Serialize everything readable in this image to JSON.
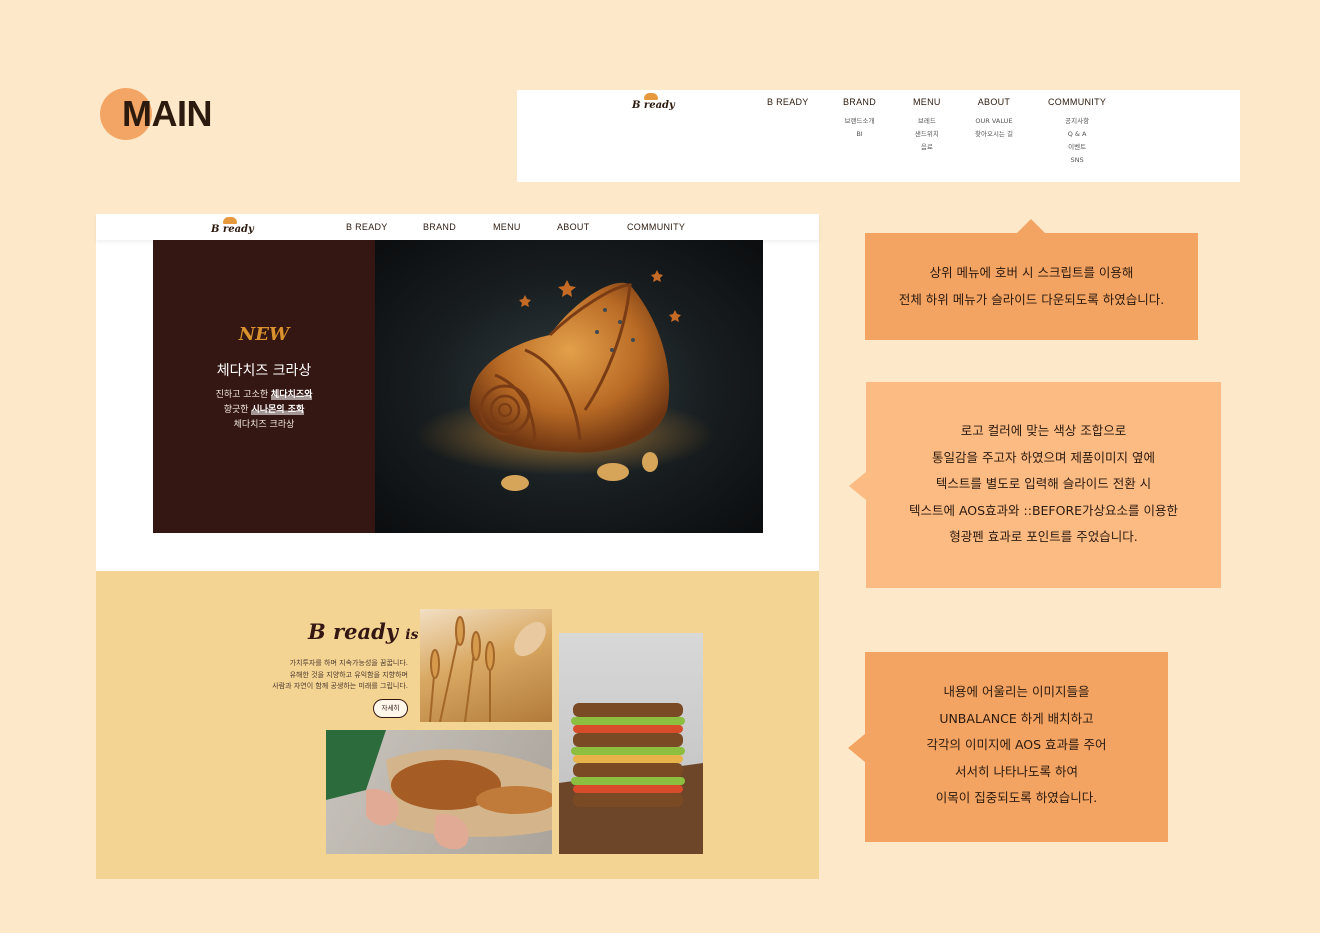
{
  "section_title": "MAIN",
  "logo": {
    "text": "B ready"
  },
  "dropdown": {
    "menus": [
      {
        "label": "B READY",
        "items": []
      },
      {
        "label": "BRAND",
        "items": [
          "브랜드소개",
          "BI"
        ]
      },
      {
        "label": "MENU",
        "items": [
          "브레드",
          "샌드위치",
          "음료"
        ]
      },
      {
        "label": "ABOUT",
        "items": [
          "OUR VALUE",
          "찾아오시는 길"
        ]
      },
      {
        "label": "COMMUNITY",
        "items": [
          "공지사항",
          "Q & A",
          "이벤트",
          "SNS"
        ]
      }
    ]
  },
  "nav": [
    "B READY",
    "BRAND",
    "MENU",
    "ABOUT",
    "COMMUNITY"
  ],
  "hero": {
    "badge": "NEW",
    "title": "체다치즈 크라상",
    "desc_1": "진하고 고소한 ",
    "desc_1_hl": "체다치즈와",
    "desc_2": "향긋한 ",
    "desc_2_hl": "시나몬의 조화",
    "desc_3": "체다치즈 크라상",
    "image": "croissant-photo"
  },
  "about": {
    "brand": "B ready",
    "brand_suffix": "is",
    "copy": [
      "가치투자를 하며 지속가능성을 꿈꿉니다.",
      "유해한 것을 지양하고 유익함을 지향하며",
      "사람과 자연이 함께 공생하는 미래를 그립니다."
    ],
    "more_button": "자세히",
    "images": [
      "wheat-field-photo",
      "bread-in-hands-photo",
      "sandwich-stack-photo"
    ]
  },
  "notes": [
    [
      "상위 메뉴에 호버 시 스크립트를 이용해",
      "전체 하위 메뉴가 슬라이드 다운되도록 하였습니다."
    ],
    [
      "로고 컬러에 맞는 색상 조합으로",
      "통일감을 주고자 하였으며 제품이미지 옆에",
      "텍스트를 별도로 입력해 슬라이드 전환 시",
      "텍스트에 AOS효과와 ::BEFORE가상요소를 이용한",
      "형광펜 효과로 포인트를 주었습니다."
    ],
    [
      "내용에 어울리는 이미지들을",
      "UNBALANCE 하게 배치하고",
      "각각의 이미지에 AOS 효과를 주어",
      "서서히 나타나도록 하여",
      "이목이 집중되도록 하였습니다."
    ]
  ],
  "colors": {
    "background": "#fde9c9",
    "accent": "#f3a463",
    "accent_light": "#fdbb84",
    "dark_brown": "#341712",
    "section_yellow": "#f4d493"
  }
}
